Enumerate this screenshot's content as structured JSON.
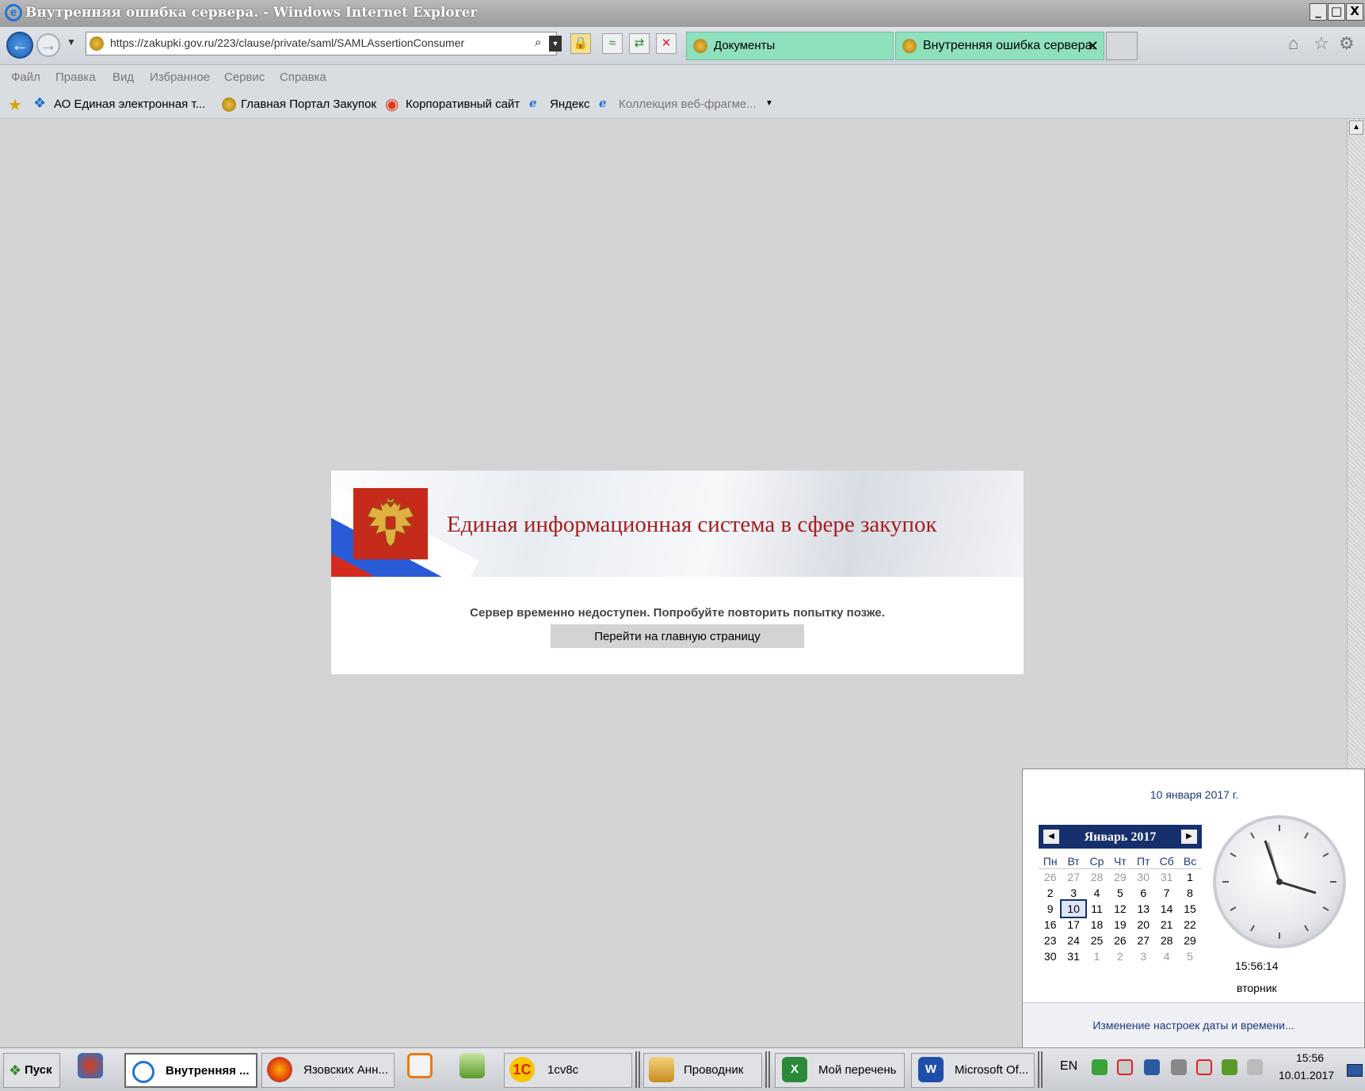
{
  "window": {
    "title": "Внутренняя ошибка сервера. - Windows Internet Explorer",
    "controls": [
      "_",
      "□",
      "X"
    ]
  },
  "navbar": {
    "url": "https://zakupki.gov.ru/223/clause/private/saml/SAMLAssertionConsumer",
    "tabs": [
      {
        "label": "Документы",
        "active": false
      },
      {
        "label": "Внутренняя ошибка сервера.",
        "active": true
      }
    ],
    "tab_close": "✕"
  },
  "menu": [
    "Файл",
    "Правка",
    "Вид",
    "Избранное",
    "Сервис",
    "Справка"
  ],
  "favorites": [
    "АО Единая электронная т...",
    "Главная Портал Закупок",
    "Корпоративный сайт",
    "Яндекс",
    "Коллекция веб-фрагме..."
  ],
  "page": {
    "banner_title": "Единая информационная система в сфере закупок",
    "message": "Сервер временно недоступен. Попробуйте повторить попытку позже.",
    "home_button": "Перейти на главную страницу"
  },
  "calendar": {
    "full_date": "10 января 2017 г.",
    "month": "Январь 2017",
    "weekdays": [
      "Пн",
      "Вт",
      "Ср",
      "Чт",
      "Пт",
      "Сб",
      "Вс"
    ],
    "weeks": [
      [
        "26",
        "27",
        "28",
        "29",
        "30",
        "31",
        "1"
      ],
      [
        "2",
        "3",
        "4",
        "5",
        "6",
        "7",
        "8"
      ],
      [
        "9",
        "10",
        "11",
        "12",
        "13",
        "14",
        "15"
      ],
      [
        "16",
        "17",
        "18",
        "19",
        "20",
        "21",
        "22"
      ],
      [
        "23",
        "24",
        "25",
        "26",
        "27",
        "28",
        "29"
      ],
      [
        "30",
        "31",
        "1",
        "2",
        "3",
        "4",
        "5"
      ]
    ],
    "selected_day": "10",
    "time": "15:56:14",
    "day_of_week": "вторник",
    "settings_link": "Изменение настроек даты и времени..."
  },
  "taskbar": {
    "start": "Пуск",
    "items": [
      {
        "label": "Внутренняя ...",
        "active": true
      },
      {
        "label": "Язовских Анн...",
        "active": false
      },
      {
        "label": "1cv8c",
        "active": false
      },
      {
        "label": "Проводник",
        "active": false
      },
      {
        "label": "Мой перечень",
        "active": false
      },
      {
        "label": "Microsoft Of...",
        "active": false
      }
    ],
    "lang": "EN",
    "clock_time": "15:56",
    "clock_date": "10.01.2017"
  },
  "colors": {
    "banner_title": "#a51e1e",
    "emblem_bg": "#c62a1a",
    "calendar_header": "#16306e",
    "link": "#1d3a7a"
  }
}
